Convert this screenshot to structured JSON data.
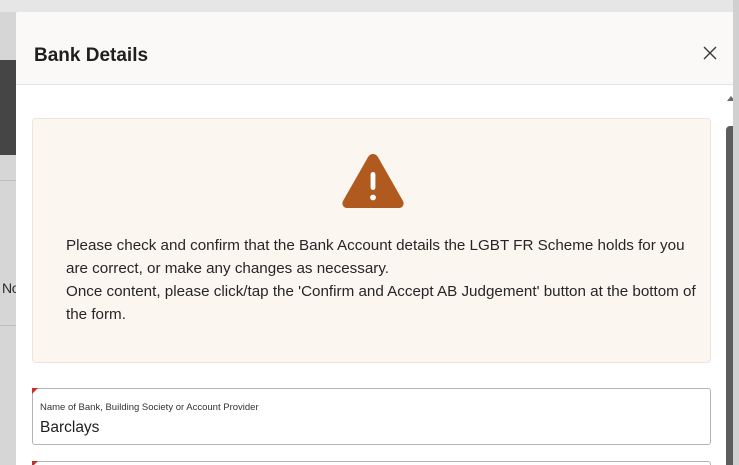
{
  "backdrop": {
    "partial_text": "No"
  },
  "modal": {
    "title": "Bank Details",
    "close_label": "Close",
    "alert": {
      "icon": "warning-triangle-icon",
      "line1": "Please check and confirm that the Bank Account details the LGBT FR Scheme holds for you are correct, or make any changes as necessary.",
      "line2": "Once content, please click/tap the 'Confirm and Accept AB Judgement' button at the bottom of the form."
    },
    "fields": {
      "bank_name": {
        "label": "Name of Bank, Building Society or Account Provider",
        "value": "Barclays",
        "required": true
      }
    }
  },
  "colors": {
    "warning": "#b05a1f",
    "alert_bg": "#fcf6f1",
    "required": "#c4302b",
    "header_bg": "#fbf9f8"
  }
}
